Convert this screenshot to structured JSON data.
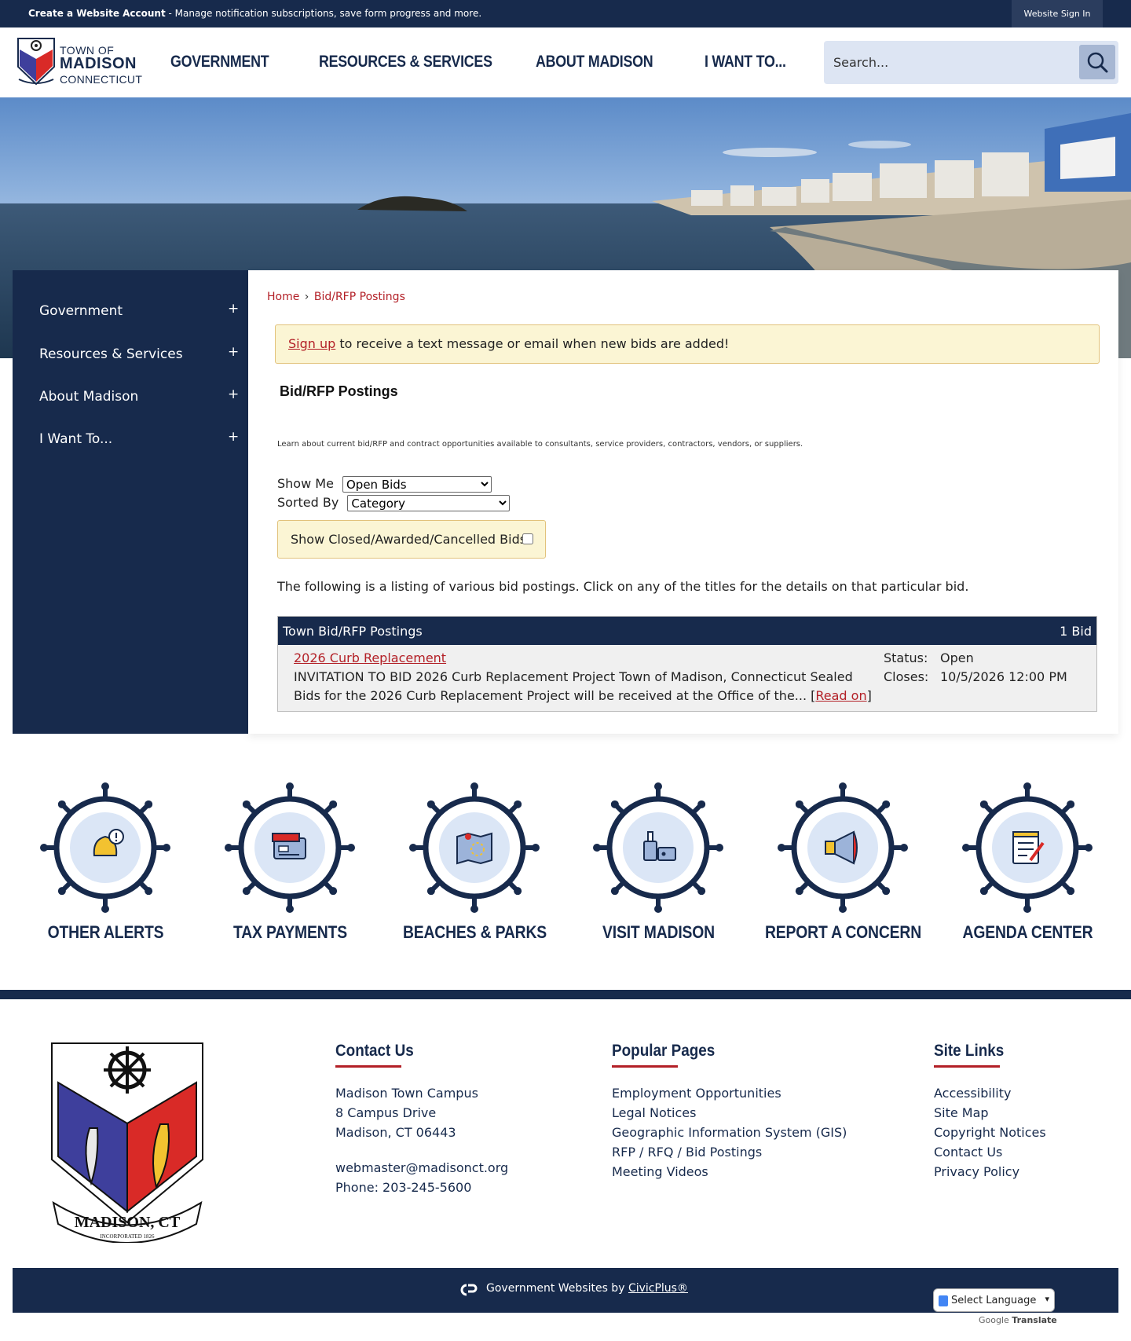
{
  "topbar": {
    "create_account": "Create a Website Account",
    "message": " - Manage notification subscriptions, save form progress and more.",
    "sign_in": "Website Sign In"
  },
  "logo": {
    "line1": "TOWN OF",
    "line2": "MADISON",
    "line3": "CONNECTICUT"
  },
  "nav": {
    "items": [
      "GOVERNMENT",
      "RESOURCES & SERVICES",
      "ABOUT MADISON",
      "I WANT TO..."
    ]
  },
  "search": {
    "placeholder": "Search..."
  },
  "sidebar": {
    "items": [
      {
        "label": "Government",
        "toggle": "+"
      },
      {
        "label": "Resources & Services",
        "toggle": "+"
      },
      {
        "label": "About Madison",
        "toggle": "+"
      },
      {
        "label": "I Want To...",
        "toggle": "+"
      }
    ]
  },
  "breadcrumb": {
    "home": "Home",
    "separator": "›",
    "current": "Bid/RFP Postings"
  },
  "alert": {
    "link": "Sign up",
    "text": " to receive a text message or email when new bids are added!"
  },
  "main": {
    "title": "Bid/RFP Postings",
    "description": "Learn about current bid/RFP and contract opportunities available to consultants, service providers, contractors, vendors, or suppliers.",
    "show_me_label": "Show Me",
    "show_me_value": "Open Bids",
    "sorted_by_label": "Sorted By",
    "sorted_by_value": "Category",
    "show_closed_label": "Show Closed/Awarded/Cancelled Bids:",
    "listing_text": "The following is a listing of various bid postings. Click on any of the titles for the details on that particular bid."
  },
  "table": {
    "header": "Town Bid/RFP Postings",
    "count": "1 Bid",
    "rows": [
      {
        "title": "2026 Curb Replacement",
        "body": "INVITATION TO BID 2026 Curb Replacement Project Town of Madison, Connecticut Sealed Bids for the 2026 Curb Replacement Project will be received at the Office of the... ",
        "read_on": "Read on",
        "status_label": "Status:",
        "status": "Open",
        "closes_label": "Closes:",
        "closes": "10/5/2026 12:00 PM"
      }
    ]
  },
  "quick_links": {
    "items": [
      {
        "label": "OTHER ALERTS",
        "icon": "bell-alert-icon"
      },
      {
        "label": "TAX PAYMENTS",
        "icon": "credit-card-icon"
      },
      {
        "label": "BEACHES & PARKS",
        "icon": "map-icon"
      },
      {
        "label": "VISIT MADISON",
        "icon": "luggage-icon"
      },
      {
        "label": "REPORT A CONCERN",
        "icon": "megaphone-icon"
      },
      {
        "label": "AGENDA CENTER",
        "icon": "notepad-icon"
      }
    ]
  },
  "footer": {
    "seal_text": "MADISON, CT",
    "seal_subtext": "INCORPORATED 1826",
    "contact": {
      "heading": "Contact Us",
      "campus": "Madison Town Campus",
      "street": "8 Campus Drive",
      "city": "Madison, CT 06443",
      "email": "webmaster@madisonct.org",
      "phone": "Phone: 203-245-5600"
    },
    "popular": {
      "heading": "Popular Pages",
      "links": [
        "Employment Opportunities",
        "Legal Notices",
        "Geographic Information System (GIS)",
        "RFP / RFQ / Bid Postings",
        "Meeting Videos"
      ]
    },
    "site_links": {
      "heading": "Site Links",
      "links": [
        "Accessibility",
        "Site Map",
        "Copyright Notices",
        "Contact Us",
        "Privacy Policy"
      ]
    },
    "credit_prefix": "Government Websites by ",
    "credit_link": "CivicPlus®",
    "translate": "Select Language",
    "powered_by": "Google",
    "translate_word": "Translate"
  },
  "colors": {
    "navy": "#172a4c",
    "accent_red": "#b32027",
    "alert_bg": "#fbf5d4"
  }
}
